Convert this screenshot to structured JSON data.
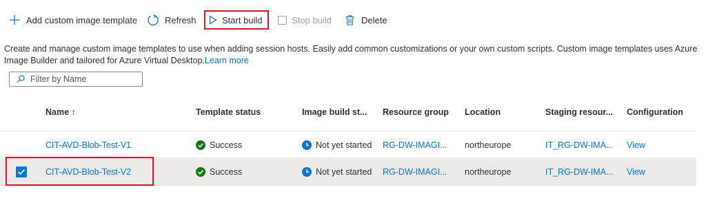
{
  "toolbar": {
    "add_label": "Add custom image template",
    "refresh_label": "Refresh",
    "start_label": "Start build",
    "stop_label": "Stop build",
    "delete_label": "Delete"
  },
  "description": {
    "text": "Create and manage custom image templates to use when adding session hosts. Easily add common customizations or your own custom scripts. Custom image templates uses Azure Image Builder and tailored for Azure Virtual Desktop.",
    "link": "Learn more"
  },
  "filter": {
    "placeholder": "Filter by Name"
  },
  "columns": {
    "name": "Name ↑",
    "template_status": "Template status",
    "image_build_status": "Image build st...",
    "resource_group": "Resource group",
    "location": "Location",
    "staging": "Staging resour...",
    "configuration": "Configuration"
  },
  "rows": [
    {
      "name": "CIT-AVD-Blob-Test-V1",
      "template_status": "Success",
      "image_build_status": "Not yet started",
      "resource_group": "RG-DW-IMAGI...",
      "location": "northeurope",
      "staging": "IT_RG-DW-IMA...",
      "configuration": "View",
      "selected": false
    },
    {
      "name": "CIT-AVD-Blob-Test-V2",
      "template_status": "Success",
      "image_build_status": "Not yet started",
      "resource_group": "RG-DW-IMAGI...",
      "location": "northeurope",
      "staging": "IT_RG-DW-IMA...",
      "configuration": "View",
      "selected": true
    }
  ],
  "colors": {
    "accent": "#0078d4",
    "success": "#107c10",
    "highlight": "#e81123",
    "selected_row": "#edebe9"
  }
}
